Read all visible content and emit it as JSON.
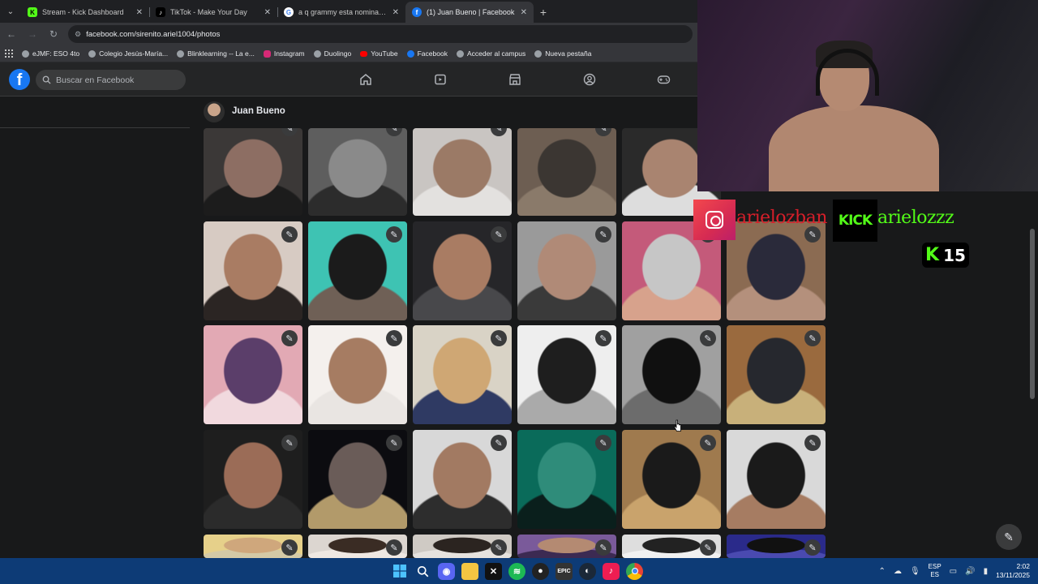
{
  "browser": {
    "tabs": [
      {
        "title": "Stream - Kick Dashboard",
        "favicon": "kick-icon",
        "active": false
      },
      {
        "title": "TikTok - Make Your Day",
        "favicon": "tiktok-icon",
        "active": false
      },
      {
        "title": "a q grammy esta nominado weekend",
        "favicon": "google-icon",
        "active": false
      },
      {
        "title": "(1) Juan Bueno | Facebook",
        "favicon": "facebook-icon",
        "active": true
      }
    ],
    "url": "facebook.com/sirenito.ariel1004/photos",
    "bookmarks": [
      "eJMF: ESO 4to",
      "Colegio Jesús-María...",
      "Blinklearning -- La e...",
      "Instagram",
      "Duolingo",
      "YouTube",
      "Facebook",
      "Acceder al campus",
      "Nueva pestaña"
    ]
  },
  "facebook": {
    "search_placeholder": "Buscar en Facebook",
    "nav_icons": [
      "home-icon",
      "video-icon",
      "marketplace-icon",
      "groups-icon",
      "gaming-icon"
    ],
    "profile_name": "Juan Bueno"
  },
  "photos": {
    "rows": [
      [
        {
          "c1": "#3b3837",
          "c2": "#8d6e63",
          "c3": "#1c1c1c"
        },
        {
          "c1": "#5e5e5e",
          "c2": "#8a8a8a",
          "c3": "#2c2c2c"
        },
        {
          "c1": "#c9c5c2",
          "c2": "#9b7a66",
          "c3": "#e3e1df"
        },
        {
          "c1": "#6d5e52",
          "c2": "#3b3632",
          "c3": "#8a7a6a"
        },
        {
          "c1": "#2a2a2a",
          "c2": "#a98470",
          "c3": "#ddd"
        }
      ],
      [
        {
          "c1": "#d7cbc3",
          "c2": "#a97c63",
          "c3": "#2b2523"
        },
        {
          "c1": "#3ec3b3",
          "c2": "#1b1b1b",
          "c3": "#6f6056"
        },
        {
          "c1": "#262629",
          "c2": "#a97c63",
          "c3": "#48484b"
        },
        {
          "c1": "#9a9a9a",
          "c2": "#b08a77",
          "c3": "#3a3a3a"
        },
        {
          "c1": "#c45a7a",
          "c2": "#c6c6c6",
          "c3": "#d7a28c"
        },
        {
          "c1": "#8b6b52",
          "c2": "#2a2a3a",
          "c3": "#b4907c"
        }
      ],
      [
        {
          "c1": "#e2a9b4",
          "c2": "#5b3e6a",
          "c3": "#f1d9de"
        },
        {
          "c1": "#f4f0ed",
          "c2": "#a67c62",
          "c3": "#e9e5e2"
        },
        {
          "c1": "#d9d3c6",
          "c2": "#cfa774",
          "c3": "#2f3a63"
        },
        {
          "c1": "#eeeeee",
          "c2": "#1e1e1e",
          "c3": "#aaaaaa"
        },
        {
          "c1": "#a0a0a0",
          "c2": "#101010",
          "c3": "#6c6c6c"
        },
        {
          "c1": "#9a6a3e",
          "c2": "#26282e",
          "c3": "#c8b07a"
        }
      ],
      [
        {
          "c1": "#1e1e1e",
          "c2": "#9b6c57",
          "c3": "#2b2b2b"
        },
        {
          "c1": "#0c0c10",
          "c2": "#6a5c58",
          "c3": "#b29a6a"
        },
        {
          "c1": "#d8d8d8",
          "c2": "#a27a62",
          "c3": "#2d2d2d"
        },
        {
          "c1": "#0a6b5a",
          "c2": "#2f8c7a",
          "c3": "#0a1f1c"
        },
        {
          "c1": "#9f7a4e",
          "c2": "#1a1a1a",
          "c3": "#c9a36c"
        },
        {
          "c1": "#d9d9d9",
          "c2": "#1a1a1a",
          "c3": "#a67c62"
        }
      ],
      [
        {
          "c1": "#e6d08a",
          "c2": "#cfa77c",
          "c3": "#d4c9a6"
        },
        {
          "c1": "#dcd6d0",
          "c2": "#3a2c24",
          "c3": "#efe8e2"
        },
        {
          "c1": "#cfcac4",
          "c2": "#2b2420",
          "c3": "#e6e2de"
        },
        {
          "c1": "#7a5a9a",
          "c2": "#b48a72",
          "c3": "#3c2a52"
        },
        {
          "c1": "#dedede",
          "c2": "#222",
          "c3": "#f1f1f1"
        },
        {
          "c1": "#2a2a8a",
          "c2": "#111",
          "c3": "#4a4ab0"
        }
      ]
    ]
  },
  "overlay": {
    "instagram_handle": "arielozban",
    "kick_logo": "KICK",
    "kick_handle": "arielozzz",
    "kick_badge_letter": "K",
    "kick_count": "15"
  },
  "taskbar": {
    "apps": [
      "windows-start-icon",
      "search-icon",
      "discord-icon",
      "file-explorer-icon",
      "capcut-icon",
      "spotify-icon",
      "obs-icon",
      "epic-games-icon",
      "steam-icon",
      "tiktok-icon",
      "chrome-icon"
    ],
    "language_top": "ESP",
    "language_bottom": "ES",
    "time": "2:02",
    "date": "13/11/2025"
  },
  "colors": {
    "facebook_blue": "#1877f2",
    "kick_green": "#53fc18",
    "instagram_red": "#d71f2a",
    "taskbar_blue": "#0d3b76"
  }
}
